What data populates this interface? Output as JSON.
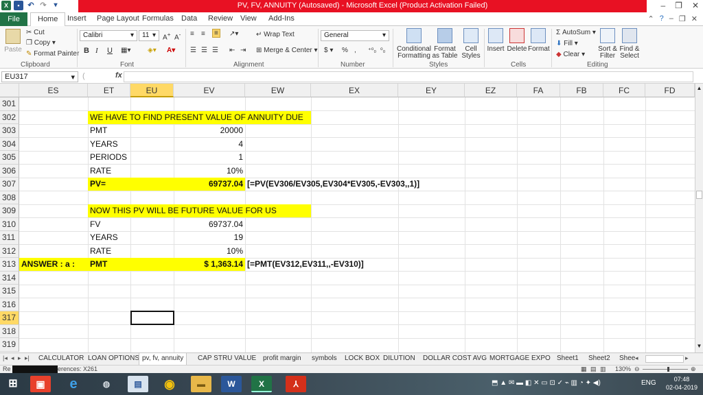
{
  "window": {
    "title": "PV, FV, ANNUITY (Autosaved) - Microsoft Excel (Product Activation Failed)",
    "buttons": [
      "–",
      "❐",
      "✕"
    ]
  },
  "ribbon_tabs": [
    "File",
    "Home",
    "Insert",
    "Page Layout",
    "Formulas",
    "Data",
    "Review",
    "View",
    "Add-Ins"
  ],
  "clipboard": {
    "paste": "Paste",
    "cut": "Cut",
    "copy": "Copy",
    "format_painter": "Format Painter",
    "label": "Clipboard"
  },
  "font": {
    "name": "Calibri",
    "size": "11",
    "label": "Font",
    "bold": "B",
    "italic": "I",
    "underline": "U"
  },
  "alignment": {
    "wrap_text": "Wrap Text",
    "merge_center": "Merge & Center",
    "label": "Alignment"
  },
  "number": {
    "format": "General",
    "label": "Number",
    "currency": "$",
    "percent": "%",
    "comma": ","
  },
  "styles": {
    "conditional": "Conditional Formatting",
    "format_table": "Format as Table",
    "cell_styles": "Cell Styles",
    "label": "Styles"
  },
  "cells": {
    "insert": "Insert",
    "delete": "Delete",
    "format": "Format",
    "label": "Cells"
  },
  "editing": {
    "autosum": "AutoSum",
    "fill": "Fill",
    "clear": "Clear",
    "sort_filter": "Sort & Filter",
    "find_select": "Find & Select",
    "label": "Editing"
  },
  "formula_bar": {
    "name_box": "EU317",
    "fx": "fx",
    "formula": ""
  },
  "columns": [
    "ES",
    "ET",
    "EU",
    "EV",
    "EW",
    "EX",
    "EY",
    "EZ",
    "FA",
    "FB",
    "FC",
    "FD"
  ],
  "selected_column": "EU",
  "rows": [
    "301",
    "302",
    "303",
    "304",
    "305",
    "306",
    "307",
    "308",
    "309",
    "310",
    "311",
    "312",
    "313",
    "314",
    "315",
    "316",
    "317",
    "318",
    "319"
  ],
  "selected_row": "317",
  "sheet": {
    "r302": {
      "header": "WE HAVE TO FIND PRESENT VALUE OF ANNUITY DUE"
    },
    "r303": {
      "label": "PMT",
      "value": "20000"
    },
    "r304": {
      "label": "YEARS",
      "value": "4"
    },
    "r305": {
      "label": "PERIODS",
      "value": "1"
    },
    "r306": {
      "label": "RATE",
      "value": "10%"
    },
    "r307": {
      "label": "PV=",
      "value": "69737.04",
      "formula": "[=PV(EV306/EV305,EV304*EV305,-EV303,,1)]"
    },
    "r309": {
      "header": "NOW THIS PV WILL BE FUTURE VALUE FOR US"
    },
    "r310": {
      "label": "FV",
      "value": "69737.04"
    },
    "r311": {
      "label": "YEARS",
      "value": "19"
    },
    "r312": {
      "label": "RATE",
      "value": "10%"
    },
    "r313": {
      "answer": "ANSWER : a :",
      "label": "PMT",
      "value": "$ 1,363.14",
      "formula": "[=PMT(EV312,EV311,,-EV310)]"
    }
  },
  "sheet_tabs": [
    "CALCULATOR",
    "LOAN OPTIONS",
    "pv, fv, annuity",
    "CAP STRU VALUE",
    "profit margin",
    "symbols",
    "LOCK BOX",
    "DILUTION",
    "DOLLAR COST AVG",
    "MORTGAGE",
    "EXPO",
    "Sheet1",
    "Sheet2",
    "Shee"
  ],
  "active_sheet": "pv, fv, annuity",
  "status": {
    "left": "erences: X261",
    "zoom": "130%"
  },
  "taskbar": {
    "lang": "ENG",
    "time": "07:48",
    "date": "02-04-2019"
  },
  "colors": {
    "highlight": "#ffff00",
    "excel_green": "#217346",
    "title_red": "#e81123"
  }
}
